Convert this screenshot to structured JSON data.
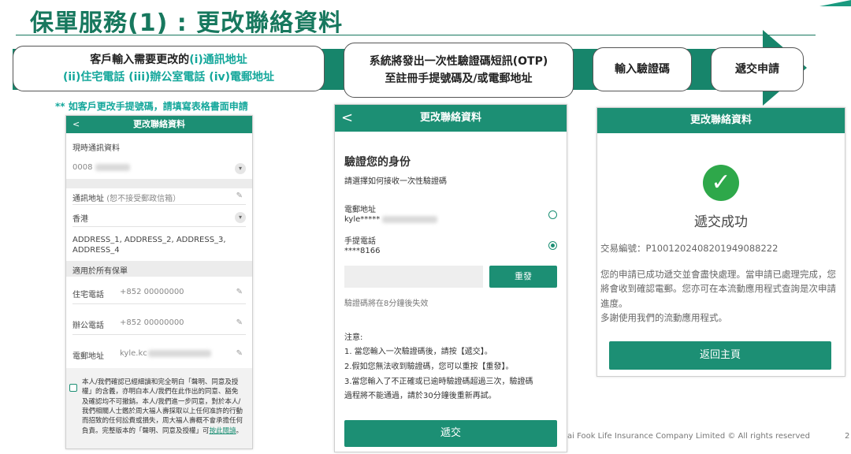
{
  "page_title": "保單服務(1) : 更改聯絡資料",
  "flow": {
    "step1_line1_prefix": "客戶輸入需要更改的",
    "step1_line1_hl": "(i)通訊地址",
    "step1_line2": "(ii)住宅電話 (iii)辦公室電話 (iv)電郵地址",
    "step2_line1": "系統將發出一次性驗證碼短訊(OTP)",
    "step2_line2": "至註冊手提號碼及/或電郵地址",
    "step3": "輸入驗證碼",
    "step4": "遞交申請"
  },
  "note": "** 如客戶更改手提號碼，請填寫表格書面申請",
  "screen1": {
    "back": "<",
    "header": "更改聯絡資料",
    "current_label": "現時通訊資料",
    "current_value": "0008",
    "address_label": "通訊地址",
    "address_hint": "(恕不接受郵政信箱）",
    "region": "香港",
    "address_lines": "ADDRESS_1, ADDRESS_2, ADDRESS_3, ADDRESS_4",
    "section_label": "適用於所有保單",
    "home_phone_label": "住宅電話",
    "home_phone_value": "+852 00000000",
    "office_phone_label": "辦公電話",
    "office_phone_value": "+852 00000000",
    "email_label": "電郵地址",
    "email_value": "kyle.kc",
    "consent_text": "本人/我們確認已經細讀和完全明白「聲明、同意及授權」的含義，亦明白本人/我們在此作出的同意、豁免及確認均不可撤銷。本人/我們進一步同意，對於本人/我們相關人士鑑於周大福人壽採取以上任何准許的行動而招致的任何訟費或損失，周大福人壽概不會承擔任何負責。完整版本的「聲明、同意及授權」可",
    "consent_link": "按此閱讀",
    "consent_end": "。"
  },
  "screen2": {
    "back": "<",
    "header": "更改聯絡資料",
    "heading": "驗證您的身份",
    "subheading": "請選擇如何接收一次性驗證碼",
    "email_label": "電郵地址",
    "email_value": "kyle*****",
    "mobile_label": "手提電話",
    "mobile_value": "****8166",
    "resend": "重發",
    "expiry": "驗證碼將在8分鐘後失效",
    "notice_title": "注意:",
    "notice_1": "1. 當您輸入一次驗證碼後，請按【遞交】。",
    "notice_2": "2.假如您無法收到驗證碼，您可以重按【重發】。",
    "notice_3a": "3.當您輸入了不正確或已逾時驗證碼超過三次，驗證碼",
    "notice_3b": "過程將不能通過，請於30分鐘後重新再試。",
    "submit": "遞交"
  },
  "screen3": {
    "header": "更改聯絡資料",
    "check": "✓",
    "success": "遞交成功",
    "txn": "交易編號：P100120240820194908822 2",
    "txn_exact": "交易編號：P1001202408201949088222",
    "para_1": "您的申請已成功遞交並會盡快處理。當申請已處理完成，您將會收到確認電郵。您亦可在本流動應用程式查詢是次申請進度。",
    "para_2": "多謝使用我們的流動應用程式。",
    "home_button": "返回主頁"
  },
  "footer": "ai Fook Life Insurance Company Limited © All rights reserved",
  "page_number": "2",
  "colors": {
    "brand_green": "#1c8f74",
    "title_green": "#17785e",
    "accent_teal": "#14a79b",
    "success_green": "#2ea84a"
  }
}
